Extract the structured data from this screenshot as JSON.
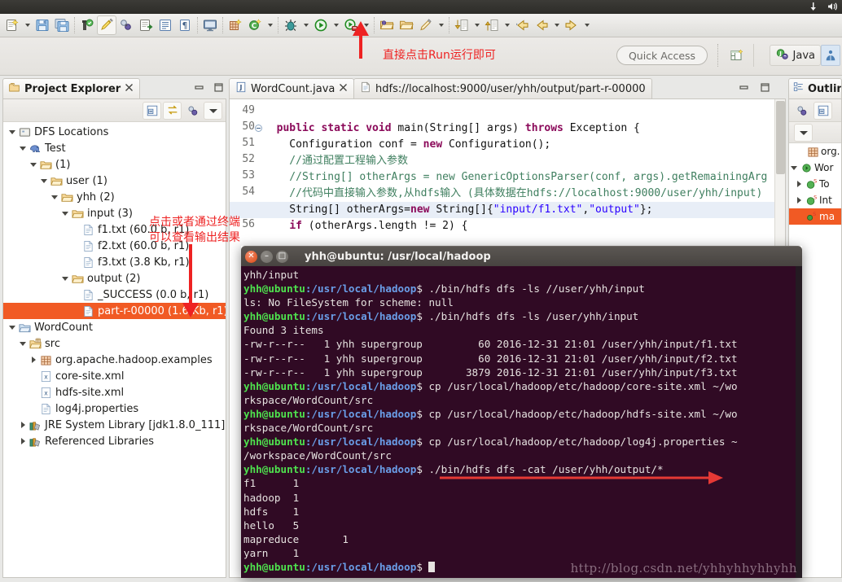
{
  "window": {
    "ubuntu_panel_icons": [
      "network-icon",
      "volume-icon"
    ]
  },
  "toolbar": {
    "groups": [
      {
        "items": [
          {
            "name": "new-wizard-icon",
            "has_dropdown": true
          },
          {
            "name": "save-icon",
            "has_dropdown": false
          },
          {
            "name": "save-all-icon",
            "has_dropdown": false
          }
        ]
      },
      {
        "items": [
          {
            "name": "publish-icon",
            "has_dropdown": false
          },
          {
            "name": "quick-fix-icon",
            "has_dropdown": false
          },
          {
            "name": "link-icon",
            "has_dropdown": false
          },
          {
            "name": "export-icon",
            "has_dropdown": false
          },
          {
            "name": "outline-icon",
            "has_dropdown": false
          },
          {
            "name": "paragraph-icon",
            "has_dropdown": false
          }
        ]
      },
      {
        "items": [
          {
            "name": "console-icon",
            "has_dropdown": false
          }
        ]
      },
      {
        "items": [
          {
            "name": "new-java-project-icon",
            "has_dropdown": false
          },
          {
            "name": "new-class-icon",
            "has_dropdown": true
          }
        ]
      },
      {
        "items": [
          {
            "name": "debug-icon",
            "has_dropdown": true
          },
          {
            "name": "run-icon",
            "has_dropdown": true
          },
          {
            "name": "run-external-icon",
            "has_dropdown": true
          }
        ]
      },
      {
        "items": [
          {
            "name": "open-folder-icon",
            "has_dropdown": false
          },
          {
            "name": "open-resource-icon",
            "has_dropdown": false
          },
          {
            "name": "search-pencil-icon",
            "has_dropdown": true
          }
        ]
      },
      {
        "items": [
          {
            "name": "next-annotation-icon",
            "has_dropdown": true
          },
          {
            "name": "previous-annotation-icon",
            "has_dropdown": true
          },
          {
            "name": "back-icon",
            "has_dropdown": false
          },
          {
            "name": "back-history-icon",
            "has_dropdown": true
          },
          {
            "name": "forward-icon",
            "has_dropdown": true
          }
        ]
      }
    ]
  },
  "quick_access": {
    "label": "Quick Access"
  },
  "perspective": {
    "open_perspective_icon": "open-perspective-icon",
    "java_label": "Java",
    "java_icon": "java-perspective-icon",
    "extra_icon": "resource-perspective-icon"
  },
  "project_explorer": {
    "title": "Project Explorer",
    "close_icon": "close-icon",
    "minimize_icon": "minimize-icon",
    "maximize_icon": "maximize-icon",
    "toolbar": [
      {
        "name": "collapse-all-icon"
      },
      {
        "name": "link-with-editor-icon"
      },
      {
        "name": "focus-on-active-task-icon"
      },
      {
        "name": "view-menu-icon"
      }
    ],
    "tree": [
      {
        "label": "DFS Locations",
        "depth": 0,
        "twisty": "down",
        "icon": "dfs-locations-icon",
        "selected": false
      },
      {
        "label": "Test",
        "depth": 1,
        "twisty": "down",
        "icon": "hadoop-elephant-icon",
        "selected": false
      },
      {
        "label": "(1)",
        "depth": 2,
        "twisty": "down",
        "icon": "folder-icon",
        "selected": false
      },
      {
        "label": "user (1)",
        "depth": 3,
        "twisty": "down",
        "icon": "folder-icon",
        "selected": false
      },
      {
        "label": "yhh (2)",
        "depth": 4,
        "twisty": "down",
        "icon": "folder-icon",
        "selected": false
      },
      {
        "label": "input (3)",
        "depth": 5,
        "twisty": "down",
        "icon": "folder-icon",
        "selected": false
      },
      {
        "label": "f1.txt (60.0 b, r1)",
        "depth": 6,
        "twisty": "none",
        "icon": "file-icon",
        "selected": false
      },
      {
        "label": "f2.txt (60.0 b, r1)",
        "depth": 6,
        "twisty": "none",
        "icon": "file-icon",
        "selected": false
      },
      {
        "label": "f3.txt (3.8 Kb, r1)",
        "depth": 6,
        "twisty": "none",
        "icon": "file-icon",
        "selected": false
      },
      {
        "label": "output (2)",
        "depth": 5,
        "twisty": "down",
        "icon": "folder-icon",
        "selected": false
      },
      {
        "label": "_SUCCESS (0.0 b, r1)",
        "depth": 6,
        "twisty": "none",
        "icon": "file-icon",
        "selected": false
      },
      {
        "label": "part-r-00000 (1.6 Kb, r1)",
        "depth": 6,
        "twisty": "none",
        "icon": "file-icon",
        "selected": true
      },
      {
        "label": "WordCount",
        "depth": 0,
        "twisty": "down",
        "icon": "project-icon",
        "selected": false
      },
      {
        "label": "src",
        "depth": 1,
        "twisty": "down",
        "icon": "source-folder-icon",
        "selected": false
      },
      {
        "label": "org.apache.hadoop.examples",
        "depth": 2,
        "twisty": "right",
        "icon": "package-icon",
        "selected": false
      },
      {
        "label": "core-site.xml",
        "depth": 2,
        "twisty": "none",
        "icon": "xml-file-icon",
        "selected": false
      },
      {
        "label": "hdfs-site.xml",
        "depth": 2,
        "twisty": "none",
        "icon": "xml-file-icon",
        "selected": false
      },
      {
        "label": "log4j.properties",
        "depth": 2,
        "twisty": "none",
        "icon": "properties-file-icon",
        "selected": false
      },
      {
        "label": "JRE System Library [jdk1.8.0_111]",
        "depth": 1,
        "twisty": "right",
        "icon": "library-icon",
        "selected": false
      },
      {
        "label": "Referenced Libraries",
        "depth": 1,
        "twisty": "right",
        "icon": "library-icon",
        "selected": false
      }
    ]
  },
  "editor": {
    "tabs": [
      {
        "label": "WordCount.java",
        "icon": "java-file-icon",
        "active": true,
        "closable": true
      },
      {
        "label": "hdfs://localhost:9000/user/yhh/output/part-r-00000",
        "icon": "text-file-icon",
        "active": false,
        "closable": false
      }
    ],
    "minimize_icon": "minimize-icon",
    "maximize_icon": "maximize-icon",
    "first_line_number": 49,
    "lines": [
      {
        "num": "49",
        "segments": [],
        "highlight": false,
        "fold": false
      },
      {
        "num": "50",
        "segments": [
          {
            "t": "  ",
            "c": "plain"
          },
          {
            "t": "public static void ",
            "c": "kw"
          },
          {
            "t": "main(String[] args) ",
            "c": "plain"
          },
          {
            "t": "throws ",
            "c": "kw"
          },
          {
            "t": "Exception {",
            "c": "plain"
          }
        ],
        "highlight": false,
        "fold": true
      },
      {
        "num": "51",
        "segments": [
          {
            "t": "    Configuration conf = ",
            "c": "plain"
          },
          {
            "t": "new ",
            "c": "kw"
          },
          {
            "t": "Configuration();",
            "c": "plain"
          }
        ],
        "highlight": false,
        "fold": false
      },
      {
        "num": "52",
        "segments": [
          {
            "t": "    //通过配置工程输入参数",
            "c": "cm"
          }
        ],
        "highlight": false,
        "fold": false
      },
      {
        "num": "53",
        "segments": [
          {
            "t": "    //String[] otherArgs = new GenericOptionsParser(conf, args).getRemainingArg",
            "c": "cm"
          }
        ],
        "highlight": false,
        "fold": false
      },
      {
        "num": "54",
        "segments": [
          {
            "t": "    //代码中直接输入参数,从hdfs输入 (具体数据在hdfs://localhost:9000/user/yhh/input)",
            "c": "cm"
          }
        ],
        "highlight": false,
        "fold": false
      },
      {
        "num": "55",
        "segments": [
          {
            "t": "    String[] otherArgs=",
            "c": "plain"
          },
          {
            "t": "new ",
            "c": "kw"
          },
          {
            "t": "String[]{",
            "c": "plain"
          },
          {
            "t": "\"input/f1.txt\"",
            "c": "st"
          },
          {
            "t": ",",
            "c": "plain"
          },
          {
            "t": "\"output\"",
            "c": "st"
          },
          {
            "t": "};",
            "c": "plain"
          }
        ],
        "highlight": true,
        "fold": false
      },
      {
        "num": "56",
        "segments": [
          {
            "t": "    ",
            "c": "plain"
          },
          {
            "t": "if ",
            "c": "kw"
          },
          {
            "t": "(otherArgs.length != ",
            "c": "plain"
          },
          {
            "t": "2",
            "c": "plain"
          },
          {
            "t": ") {",
            "c": "plain"
          }
        ],
        "highlight": false,
        "fold": false
      }
    ]
  },
  "outline": {
    "title": "Outline",
    "toolbar": [
      {
        "name": "focus-icon"
      },
      {
        "name": "collapse-all-icon"
      },
      {
        "name": "view-menu-icon"
      }
    ],
    "rows": [
      {
        "label": "org.",
        "icon": "package-icon",
        "twisty": "none",
        "selected": false
      },
      {
        "label": "Wor",
        "icon": "class-icon",
        "twisty": "down",
        "selected": false
      },
      {
        "label": "To",
        "icon": "class-static-icon",
        "twisty": "right",
        "selected": false
      },
      {
        "label": "Int",
        "icon": "class-static-icon",
        "twisty": "right",
        "selected": false
      },
      {
        "label": "ma",
        "icon": "method-icon",
        "twisty": "none",
        "selected": true
      }
    ]
  },
  "terminal": {
    "title": "yhh@ubuntu: /usr/local/hadoop",
    "close_icon": "close-icon",
    "minimize_icon": "minimize-icon",
    "maximize_icon": "maximize-icon",
    "prompt_user": "yhh@ubuntu",
    "prompt_path": ":/usr/local/hadoop",
    "prompt_tail": "$ ",
    "lines": [
      {
        "type": "out",
        "text": "yhh/input"
      },
      {
        "type": "cmd",
        "text": "./bin/hdfs dfs -ls //user/yhh/input"
      },
      {
        "type": "out",
        "text": "ls: No FileSystem for scheme: null"
      },
      {
        "type": "cmd",
        "text": "./bin/hdfs dfs -ls /user/yhh/input"
      },
      {
        "type": "out",
        "text": "Found 3 items"
      },
      {
        "type": "out",
        "text": "-rw-r--r--   1 yhh supergroup         60 2016-12-31 21:01 /user/yhh/input/f1.txt"
      },
      {
        "type": "out",
        "text": "-rw-r--r--   1 yhh supergroup         60 2016-12-31 21:01 /user/yhh/input/f2.txt"
      },
      {
        "type": "out",
        "text": "-rw-r--r--   1 yhh supergroup       3879 2016-12-31 21:01 /user/yhh/input/f3.txt"
      },
      {
        "type": "cmd",
        "text": "cp /usr/local/hadoop/etc/hadoop/core-site.xml ~/wo"
      },
      {
        "type": "out",
        "text": "rkspace/WordCount/src"
      },
      {
        "type": "cmd",
        "text": "cp /usr/local/hadoop/etc/hadoop/hdfs-site.xml ~/wo"
      },
      {
        "type": "out",
        "text": "rkspace/WordCount/src"
      },
      {
        "type": "cmd",
        "text": "cp /usr/local/hadoop/etc/hadoop/log4j.properties ~"
      },
      {
        "type": "out",
        "text": "/workspace/WordCount/src"
      },
      {
        "type": "cmd",
        "text": "./bin/hdfs dfs -cat /user/yhh/output/*"
      },
      {
        "type": "out",
        "text": "f1      1"
      },
      {
        "type": "out",
        "text": "hadoop  1"
      },
      {
        "type": "out",
        "text": "hdfs    1"
      },
      {
        "type": "out",
        "text": "hello   5"
      },
      {
        "type": "out",
        "text": "mapreduce       1"
      },
      {
        "type": "out",
        "text": "yarn    1"
      },
      {
        "type": "prompt",
        "text": ""
      }
    ],
    "watermark": "http://blog.csdn.net/yhhyhhyhhyhh"
  },
  "annotations": [
    {
      "name": "run-annotation",
      "text": "直接点击Run运行即可"
    },
    {
      "name": "output-annotation-line1",
      "text": "点击或者通过终端"
    },
    {
      "name": "output-annotation-line2",
      "text": "可以查看输出结果"
    }
  ]
}
